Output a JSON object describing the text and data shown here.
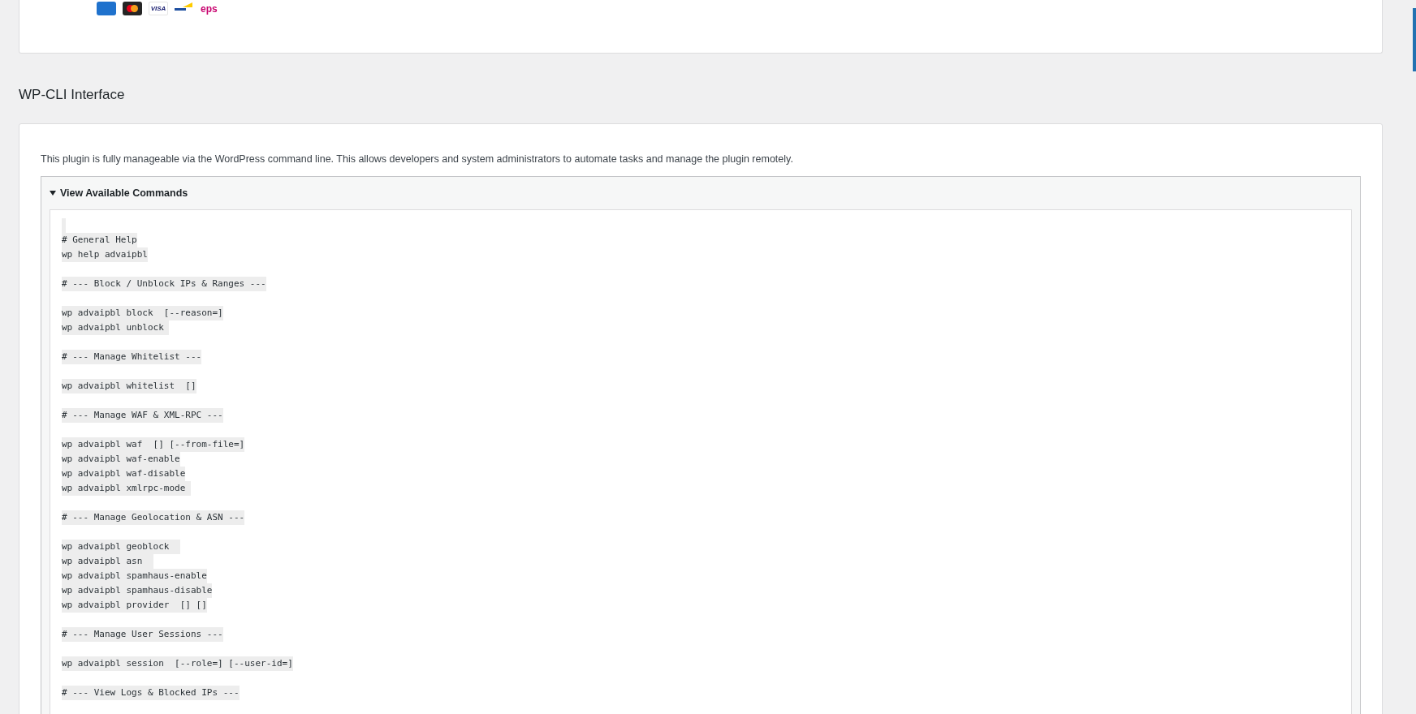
{
  "payment_logos": [
    {
      "kind": "card-blue"
    },
    {
      "kind": "card-circles"
    },
    {
      "kind": "wordmark",
      "text": "VISA"
    },
    {
      "kind": "stripes"
    },
    {
      "kind": "wordmark-eps",
      "text": "eps"
    }
  ],
  "section": {
    "title": "WP-CLI Interface",
    "description": "This plugin is fully manageable via the WordPress command line. This allows developers and system administrators to automate tasks and manage the plugin remotely.",
    "details": {
      "summary": "View Available Commands",
      "expanded": true,
      "blocks": [
        [
          "# General Help",
          "wp help advaipbl"
        ],
        [
          "# --- Block / Unblock IPs & Ranges ---"
        ],
        [
          "wp advaipbl block  [--reason=]",
          "wp advaipbl unblock "
        ],
        [
          "# --- Manage Whitelist ---"
        ],
        [
          "wp advaipbl whitelist  []"
        ],
        [
          "# --- Manage WAF & XML-RPC ---"
        ],
        [
          "wp advaipbl waf  [] [--from-file=]",
          "wp advaipbl waf-enable",
          "wp advaipbl waf-disable",
          "wp advaipbl xmlrpc-mode "
        ],
        [
          "# --- Manage Geolocation & ASN ---"
        ],
        [
          "wp advaipbl geoblock  ",
          "wp advaipbl asn  ",
          "wp advaipbl spamhaus-enable",
          "wp advaipbl spamhaus-disable",
          "wp advaipbl provider  [] []"
        ],
        [
          "# --- Manage User Sessions ---"
        ],
        [
          "wp advaipbl session  [--role=] [--user-id=]"
        ],
        [
          "# --- View Logs & Blocked IPs ---"
        ]
      ]
    }
  }
}
